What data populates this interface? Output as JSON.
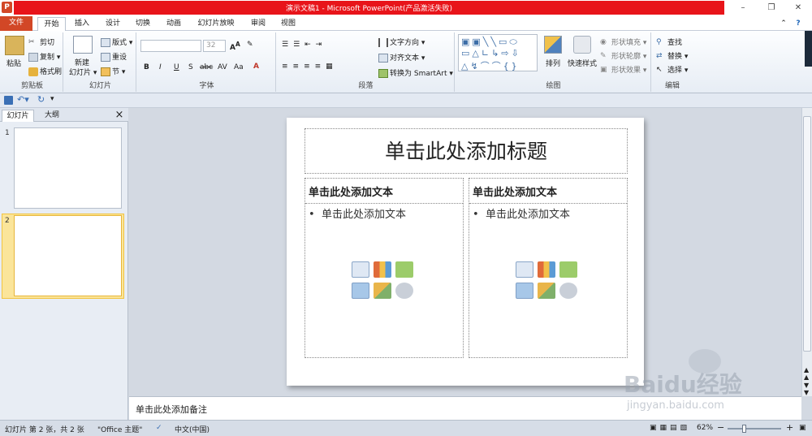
{
  "window": {
    "title": "演示文稿1 - Microsoft PowerPoint(产品激活失败)",
    "app_icon": "P"
  },
  "tabs": [
    {
      "label": "文件"
    },
    {
      "label": "开始"
    },
    {
      "label": "插入"
    },
    {
      "label": "设计"
    },
    {
      "label": "切换"
    },
    {
      "label": "动画"
    },
    {
      "label": "幻灯片放映"
    },
    {
      "label": "审阅"
    },
    {
      "label": "视图"
    }
  ],
  "ribbon": {
    "clipboard": {
      "paste": "粘贴",
      "cut": "剪切",
      "copy": "复制",
      "format_painter": "格式刷",
      "group": "剪贴板"
    },
    "slides": {
      "new_slide_1": "新建",
      "new_slide_2": "幻灯片",
      "layout": "版式",
      "reset": "重设",
      "section": "节",
      "group": "幻灯片"
    },
    "font": {
      "font_size": "32",
      "group": "字体",
      "bold": "B",
      "italic": "I",
      "underline": "U",
      "shadow": "S",
      "strike": "abc",
      "spacing": "AV",
      "case": "Aa"
    },
    "paragraph": {
      "text_direction": "文字方向",
      "align_text": "对齐文本",
      "smartart": "转换为 SmartArt",
      "group": "段落"
    },
    "drawing": {
      "arrange": "排列",
      "quick_styles": "快速样式",
      "shape_fill": "形状填充",
      "shape_outline": "形状轮廓",
      "shape_effects": "形状效果",
      "group": "绘图"
    },
    "editing": {
      "find": "查找",
      "replace": "替换",
      "select": "选择",
      "group": "编辑"
    }
  },
  "left_pane": {
    "tabs": [
      {
        "label": "幻灯片"
      },
      {
        "label": "大纲"
      }
    ],
    "close": "×",
    "thumbnails": [
      {
        "num": "1"
      },
      {
        "num": "2"
      }
    ]
  },
  "slide": {
    "title_placeholder": "单击此处添加标题",
    "left_heading": "单击此处添加文本",
    "left_bullet": "单击此处添加文本",
    "right_heading": "单击此处添加文本",
    "right_bullet": "单击此处添加文本"
  },
  "notes": {
    "placeholder": "单击此处添加备注"
  },
  "status": {
    "slide_info": "幻灯片 第 2 张，共 2 张",
    "theme": "\"Office 主题\"",
    "language": "中文(中国)",
    "zoom": "62%"
  },
  "watermark": {
    "text": "Baidu经验",
    "url": "jingyan.baidu.com"
  },
  "colors": {
    "accent_red": "#e8141a",
    "file_tab": "#d24726",
    "selected_thumb": "#f7c64b"
  }
}
